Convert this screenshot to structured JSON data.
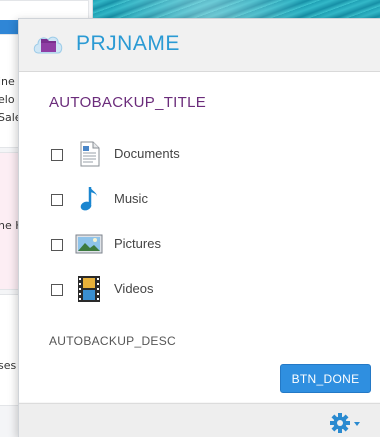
{
  "background_app": {
    "text_lines": [
      "ine",
      "elo",
      "Sale",
      "he H",
      "ses"
    ]
  },
  "popup": {
    "app_name": "PRJNAME",
    "section_title": "AUTOBACKUP_TITLE",
    "options": [
      {
        "label": "Documents",
        "icon": "document-icon",
        "checked": false
      },
      {
        "label": "Music",
        "icon": "music-note-icon",
        "checked": false
      },
      {
        "label": "Pictures",
        "icon": "picture-icon",
        "checked": false
      },
      {
        "label": "Videos",
        "icon": "film-strip-icon",
        "checked": false
      }
    ],
    "description": "AUTOBACKUP_DESC",
    "done_button": "BTN_DONE",
    "footer": {
      "settings_icon": "gear-icon",
      "dropdown_icon": "caret-down-icon"
    }
  },
  "colors": {
    "accent_blue": "#2a9ad4",
    "title_purple": "#6b2c7b",
    "button_blue": "#2f8fe0"
  }
}
